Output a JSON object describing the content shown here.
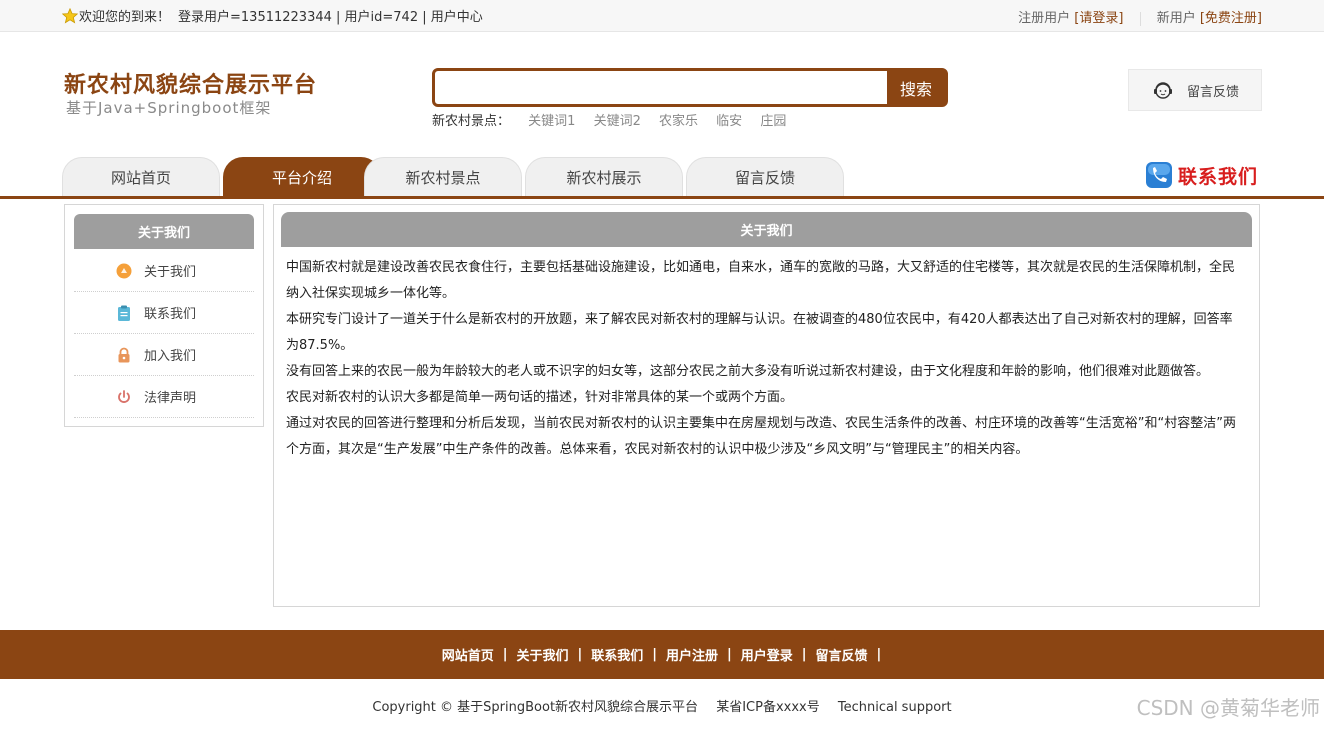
{
  "topbar": {
    "welcome": "欢迎您的到来！",
    "user_info": "登录用户=13511223344 | 用户id=742 | 用户中心",
    "login_prefix": "注册用户",
    "login_link": "[请登录]",
    "register_prefix": "新用户",
    "register_link": "[免费注册]"
  },
  "header": {
    "title": "新农村风貌综合展示平台",
    "subtitle": "基于Java+Springboot框架",
    "search_button": "搜索",
    "search_placeholder": "",
    "hotwords_label": "新农村景点：",
    "hotwords": [
      "关键词1",
      "关键词2",
      "农家乐",
      "临安",
      "庄园"
    ],
    "feedback": "留言反馈",
    "contact": "联系我们"
  },
  "nav": {
    "items": [
      {
        "label": "网站首页"
      },
      {
        "label": "平台介绍"
      },
      {
        "label": "新农村景点"
      },
      {
        "label": "新农村展示"
      },
      {
        "label": "留言反馈"
      }
    ],
    "active": "平台介绍"
  },
  "sidebar": {
    "title": "关于我们",
    "items": [
      {
        "label": "关于我们",
        "icon": "orange-circle-icon"
      },
      {
        "label": "联系我们",
        "icon": "clipboard-icon"
      },
      {
        "label": "加入我们",
        "icon": "lock-icon"
      },
      {
        "label": "法律声明",
        "icon": "power-icon"
      }
    ]
  },
  "main": {
    "title": "关于我们",
    "paragraphs": [
      "中国新农村就是建设改善农民衣食住行，主要包括基础设施建设，比如通电，自来水，通车的宽敞的马路，大又舒适的住宅楼等，其次就是农民的生活保障机制，全民纳入社保实现城乡一体化等。",
      " 本研究专门设计了一道关于什么是新农村的开放题，来了解农民对新农村的理解与认识。在被调查的480位农民中，有420人都表达出了自己对新农村的理解，回答率为87.5%。",
      "没有回答上来的农民一般为年龄较大的老人或不识字的妇女等，这部分农民之前大多没有听说过新农村建设，由于文化程度和年龄的影响，他们很难对此题做答。",
      " 农民对新农村的认识大多都是简单一两句话的描述，针对非常具体的某一个或两个方面。",
      "通过对农民的回答进行整理和分析后发现，当前农民对新农村的认识主要集中在房屋规划与改造、农民生活条件的改善、村庄环境的改善等“生活宽裕”和“村容整洁”两个方面，其次是“生产发展”中生产条件的改善。总体来看，农民对新农村的认识中极少涉及“乡风文明”与“管理民主”的相关内容。"
    ]
  },
  "footer": {
    "links": [
      "网站首页",
      "关于我们",
      "联系我们",
      "用户注册",
      "用户登录",
      "留言反馈"
    ],
    "separator": "|",
    "copyright": "Copyright © 基于SpringBoot新农村风貌综合展示平台",
    "icp": "某省ICP备xxxx号",
    "support": "Technical support"
  },
  "watermark": "CSDN @黄菊华老师",
  "colors": {
    "brand": "#8b4513",
    "header_gray": "#9e9e9e",
    "contact_red": "#d81e1e"
  }
}
